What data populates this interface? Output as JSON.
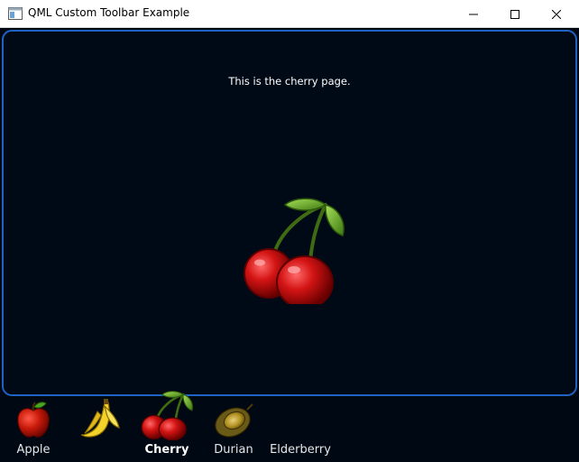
{
  "window": {
    "title": "QML Custom Toolbar Example",
    "icon": "app-window-icon",
    "controls": [
      "minimize-icon",
      "maximize-icon",
      "close-icon"
    ]
  },
  "page": {
    "text": "This is the cherry page.",
    "image": "cherry-icon"
  },
  "toolbar": {
    "active": "Cherry",
    "items": [
      {
        "label": "Apple",
        "icon": "apple-icon"
      },
      {
        "label": "",
        "icon": "banana-icon"
      },
      {
        "label": "Cherry",
        "icon": "cherry-icon"
      },
      {
        "label": "Durian",
        "icon": "durian-icon"
      },
      {
        "label": "Elderberry",
        "icon": ""
      }
    ]
  },
  "colors": {
    "background": "#000814",
    "page_border": "#1e63c4",
    "text": "#ffffff"
  }
}
